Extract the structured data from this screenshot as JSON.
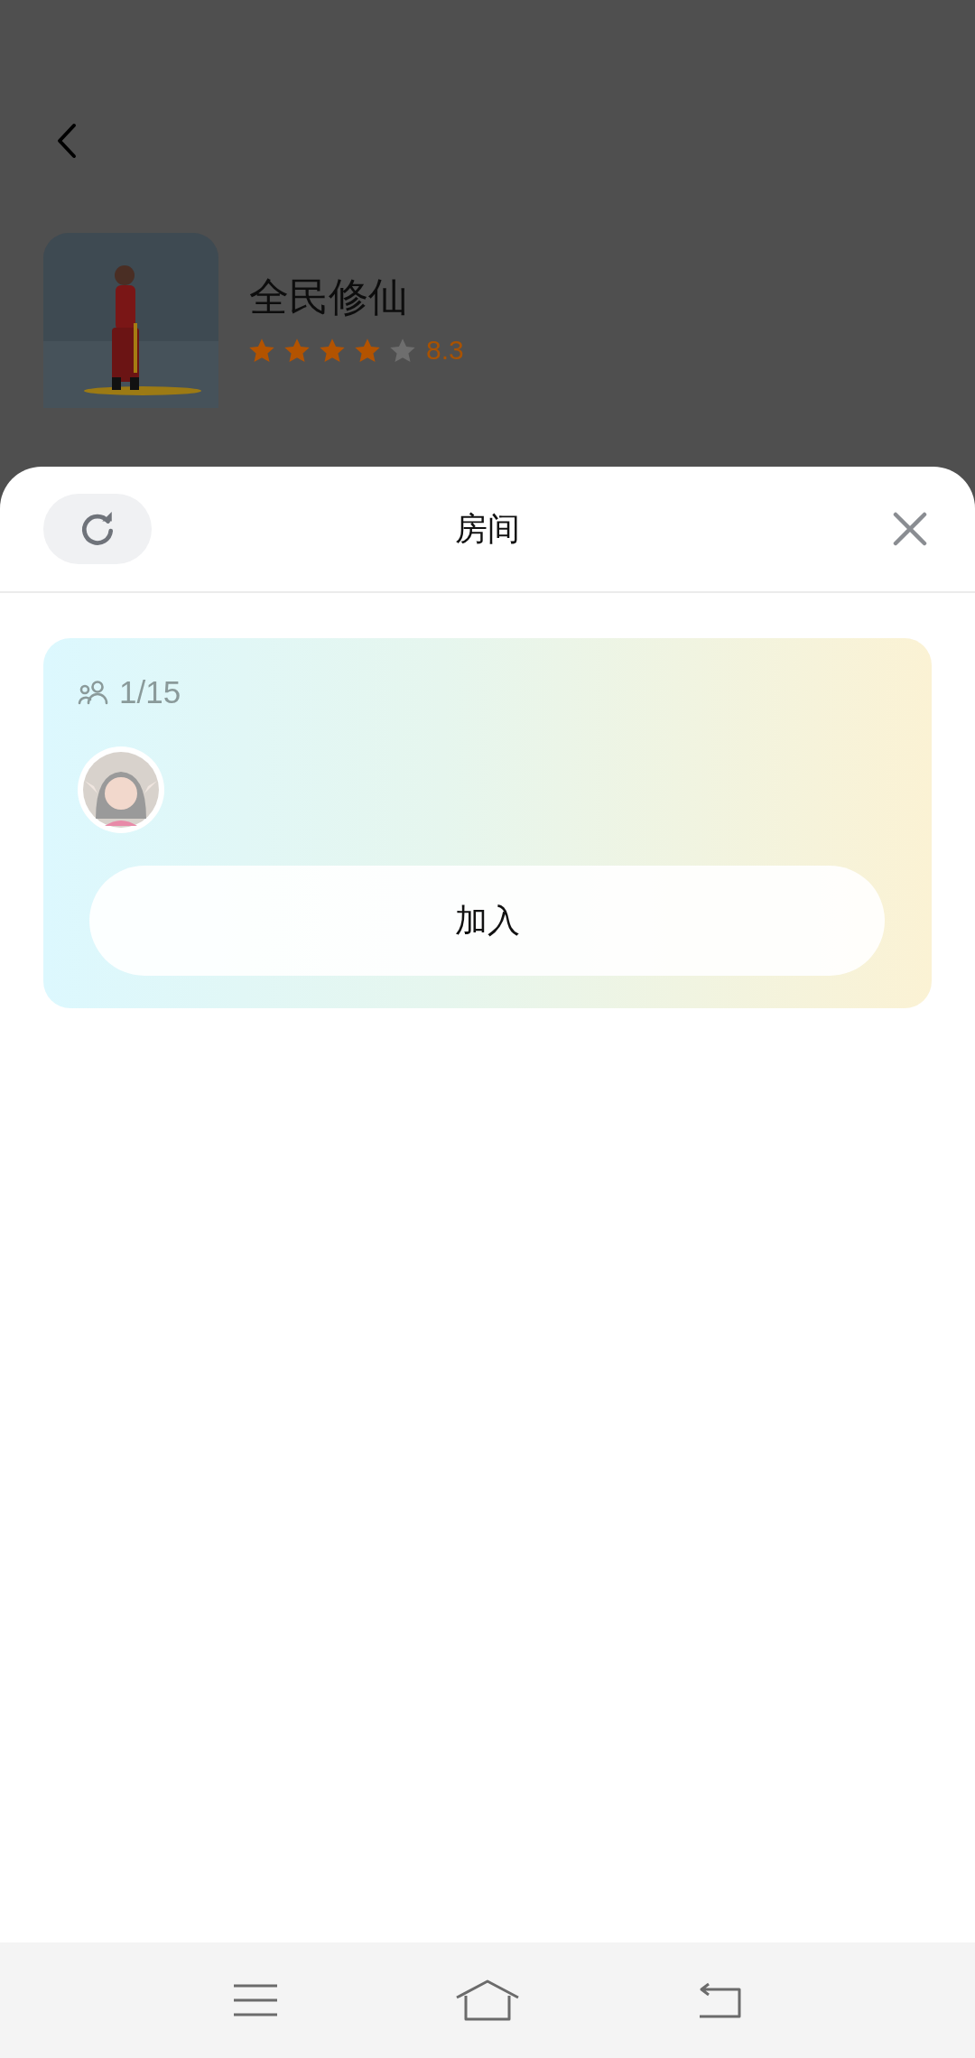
{
  "game": {
    "title": "全民修仙",
    "stars": 4,
    "rating": "8.3"
  },
  "sheet": {
    "title": "房间"
  },
  "rooms": [
    {
      "members": "1/15",
      "players": [
        {
          "kind": "avatar"
        }
      ],
      "join_label": "加入"
    }
  ]
}
